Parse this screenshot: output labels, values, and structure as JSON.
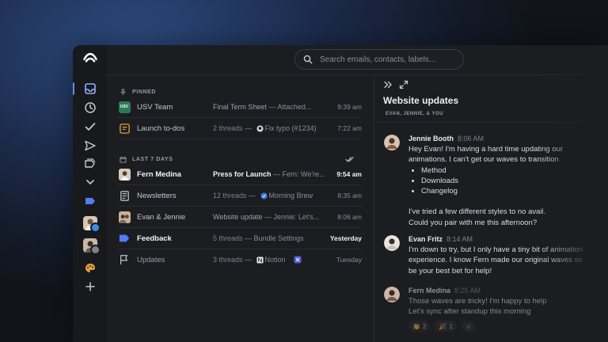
{
  "search": {
    "placeholder": "Search emails, contacts, labels..."
  },
  "sections": {
    "pinned": "PINNED",
    "recent": "LAST 7 DAYS"
  },
  "pinned": [
    {
      "name": "USV Team",
      "badge": "USV",
      "subject": "Final Term Sheet",
      "sep": " — ",
      "snippet": "Attached...",
      "time": "9:39 am"
    },
    {
      "name": "Launch to-dos",
      "threads": "2 threads",
      "sep": " — ",
      "snippet": "Fix typo (#1234)",
      "time": "7:22 am"
    }
  ],
  "recent": [
    {
      "name": "Fern Medina",
      "subject": "Press for Launch",
      "sep": " — ",
      "snippet": "Fern: We're...",
      "time": "9:54 am",
      "unread": true
    },
    {
      "name": "Newsletters",
      "threads": "12 threads",
      "sep": " — ",
      "snippet": "Morning Brew",
      "time": "8:35 am"
    },
    {
      "name": "Evan & Jennie",
      "subject": "Website update",
      "sep": " — ",
      "snippet": "Jennie: Let's...",
      "time": "8:06 am"
    },
    {
      "name": "Feedback",
      "threads": "5 threads",
      "sep": " — ",
      "snippet": "Bundle Settings",
      "time": "Yesterday",
      "unread": true
    },
    {
      "name": "Updates",
      "threads": "3 threads",
      "sep": " — ",
      "snippet": "Notion",
      "time": "Tuesday",
      "dim": true
    }
  ],
  "detail": {
    "title": "Website updates",
    "participants": "EVAN, JENNIE, & YOU",
    "messages": [
      {
        "author": "Jennie Booth",
        "time": "8:06 AM",
        "line1": "Hey Evan! I'm having a hard time updating our",
        "line2": "animations. I can't get our waves to transition",
        "bullets": [
          "Method",
          "Downloads",
          "Changelog"
        ],
        "line3": "I've tried a few different styles to no avail.",
        "line4": "Could you pair with me this afternoon?"
      },
      {
        "author": "Evan Fritz",
        "time": "8:14 AM",
        "line1": "I'm down to try, but I only have a tiny bit of animation",
        "line2": "experience. I know Fern made our original waves so",
        "line3": "be your best bet for help!"
      },
      {
        "author": "Fern Medina",
        "time": "8:25 AM",
        "line1": "Those waves are tricky! I'm happy to help",
        "line2": "Let's sync after standup this morning"
      }
    ],
    "reactions": [
      "2",
      "1"
    ]
  },
  "colors": {
    "accent": "#5b8cff",
    "background": "#1c1d21",
    "rail": "#18191d"
  }
}
